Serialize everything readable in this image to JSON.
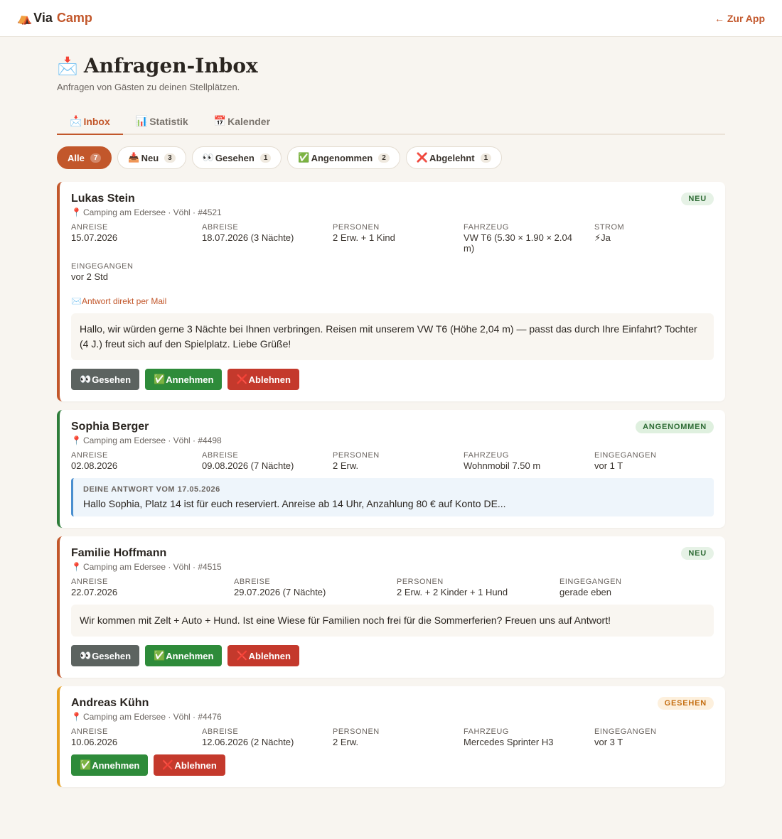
{
  "header": {
    "logo_icon": "⛺",
    "logo_via": "Via",
    "logo_camp": "Camp",
    "back_label": "← Zur App"
  },
  "page": {
    "title_icon": "📩",
    "title": "Anfragen-Inbox",
    "subtitle": "Anfragen von Gästen zu deinen Stellplätzen."
  },
  "tabs": [
    {
      "icon": "📩",
      "label": "Inbox"
    },
    {
      "icon": "📊",
      "label": "Statistik"
    },
    {
      "icon": "📅",
      "label": "Kalender"
    }
  ],
  "filters": [
    {
      "icon": "",
      "label": "Alle",
      "count": "7"
    },
    {
      "icon": "📥",
      "label": "Neu",
      "count": "3"
    },
    {
      "icon": "👀",
      "label": "Gesehen",
      "count": "1"
    },
    {
      "icon": "✅",
      "label": "Angenommen",
      "count": "2"
    },
    {
      "icon": "❌",
      "label": "Abgelehnt",
      "count": "1"
    }
  ],
  "icons": {
    "pin": "📍",
    "mail": "✉️",
    "eyes": "👀",
    "check": "✅",
    "cross": "❌",
    "bolt": "⚡"
  },
  "buttons": {
    "seen": "Gesehen",
    "accept": "Annehmen",
    "reject": "Ablehnen"
  },
  "labels": {
    "arrival": "ANREISE",
    "departure": "ABREISE",
    "persons": "PERSONEN",
    "vehicle": "FAHRZEUG",
    "power": "STROM",
    "received": "EINGEGANGEN",
    "reply_mail": "Antwort direkt per Mail"
  },
  "cards": [
    {
      "name": "Lukas Stein",
      "location": "Camping am Edersee · Vöhl · #4521",
      "badge": "NEU",
      "arrival": "15.07.2026",
      "departure": "18.07.2026 (3 Nächte)",
      "persons": "2 Erw. + 1 Kind",
      "vehicle": "VW T6 (5.30 × 1.90 × 2.04 m)",
      "power": "Ja",
      "received": "vor 2 Std",
      "message": "Hallo, wir würden gerne 3 Nächte bei Ihnen verbringen. Reisen mit unserem VW T6 (Höhe 2,04 m) — passt das durch Ihre Einfahrt? Tochter (4 J.) freut sich auf den Spielplatz. Liebe Grüße!"
    },
    {
      "name": "Sophia Berger",
      "location": "Camping am Edersee · Vöhl · #4498",
      "badge": "ANGENOMMEN",
      "arrival": "02.08.2026",
      "departure": "09.08.2026 (7 Nächte)",
      "persons": "2 Erw.",
      "vehicle": "Wohnmobil 7.50 m",
      "received": "vor 1 T",
      "response_label": "DEINE ANTWORT VOM 17.05.2026",
      "response_text": "Hallo Sophia, Platz 14 ist für euch reserviert. Anreise ab 14 Uhr, Anzahlung 80 € auf Konto DE..."
    },
    {
      "name": "Familie Hoffmann",
      "location": "Camping am Edersee · Vöhl · #4515",
      "badge": "NEU",
      "arrival": "22.07.2026",
      "departure": "29.07.2026 (7 Nächte)",
      "persons": "2 Erw. + 2 Kinder + 1 Hund",
      "received": "gerade eben",
      "message": "Wir kommen mit Zelt + Auto + Hund. Ist eine Wiese für Familien noch frei für die Sommerferien? Freuen uns auf Antwort!"
    },
    {
      "name": "Andreas Kühn",
      "location": "Camping am Edersee · Vöhl · #4476",
      "badge": "GESEHEN",
      "arrival": "10.06.2026",
      "departure": "12.06.2026 (2 Nächte)",
      "persons": "2 Erw.",
      "vehicle": "Mercedes Sprinter H3",
      "received": "vor 3 T"
    }
  ]
}
